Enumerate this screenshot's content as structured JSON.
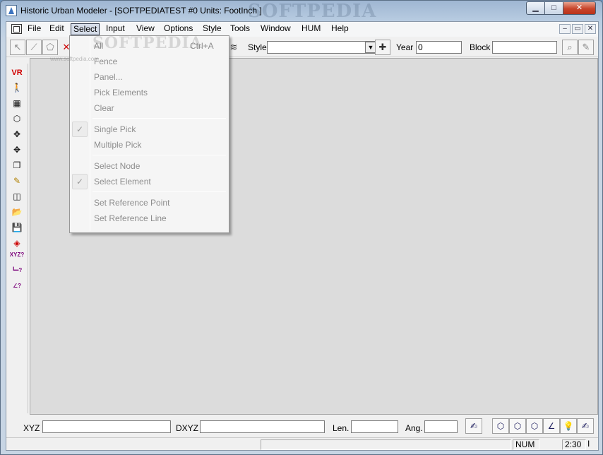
{
  "window": {
    "title": "Historic Urban Modeler - [SOFTPEDIATEST #0  Units: FootInch ]",
    "watermark": "SOFTPEDIA",
    "minimize": "▁",
    "maximize": "□",
    "close": "✕"
  },
  "menubar": {
    "items": [
      "File",
      "Edit",
      "Select",
      "Input",
      "View",
      "Options",
      "Style",
      "Tools",
      "Window",
      "HUM",
      "Help"
    ],
    "open_item": "Select",
    "mdi_buttons": [
      "–",
      "▭",
      "✕"
    ]
  },
  "toolbar": {
    "style_label": "Style",
    "style_value": "",
    "year_label": "Year",
    "year_value": "0",
    "block_label": "Block",
    "block_value": ""
  },
  "select_menu": {
    "items": [
      {
        "label": "All",
        "shortcut": "Ctrl+A",
        "checked": false
      },
      {
        "label": "Fence",
        "shortcut": "",
        "checked": false
      },
      {
        "label": "Panel...",
        "shortcut": "",
        "checked": false
      },
      {
        "label": "Pick Elements",
        "shortcut": "",
        "checked": false
      },
      {
        "label": "Clear",
        "shortcut": "",
        "checked": false
      },
      {
        "label": "Single Pick",
        "shortcut": "",
        "checked": true
      },
      {
        "label": "Multiple Pick",
        "shortcut": "",
        "checked": false
      },
      {
        "label": "Select Node",
        "shortcut": "",
        "checked": false
      },
      {
        "label": "Select Element",
        "shortcut": "",
        "checked": true
      },
      {
        "label": "Set Reference Point",
        "shortcut": "",
        "checked": false
      },
      {
        "label": "Set Reference Line",
        "shortcut": "",
        "checked": false
      }
    ],
    "watermark": "SOFTPEDIA",
    "watermark_url": "www.softpedia.com"
  },
  "palette": {
    "vr_label": "VR",
    "xyz_label": "XYZ"
  },
  "coordbar": {
    "xyz_label": "XYZ",
    "dxyz_label": "DXYZ",
    "len_label": "Len.",
    "ang_label": "Ang.",
    "xyz_value": "",
    "dxyz_value": "",
    "len_value": "",
    "ang_value": ""
  },
  "statusbar": {
    "num": "NUM",
    "time": "2:30",
    "indicator": "I"
  }
}
